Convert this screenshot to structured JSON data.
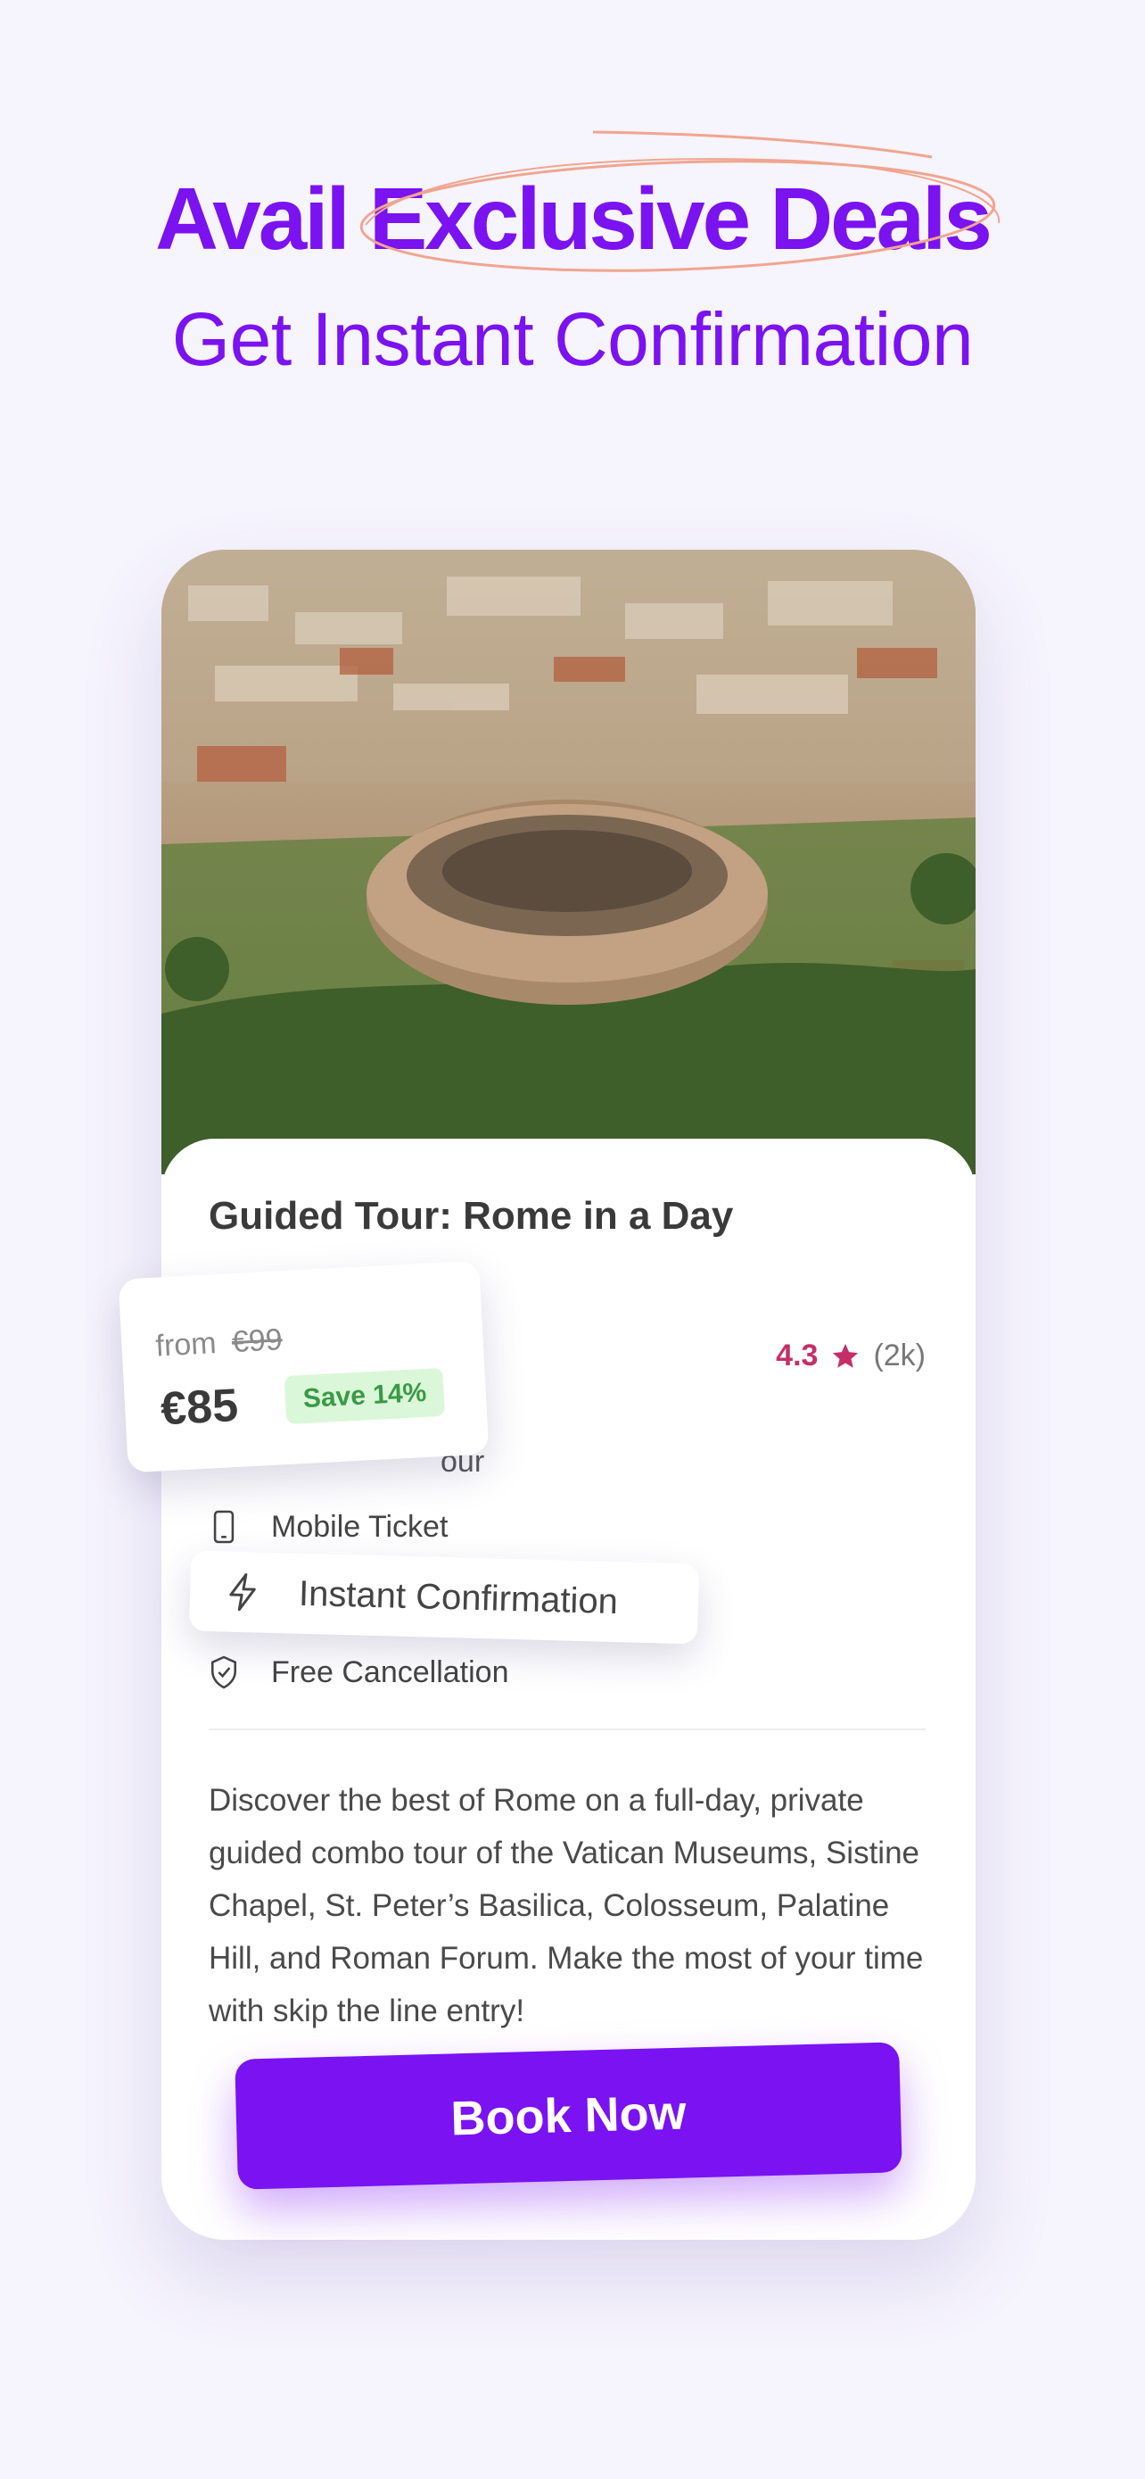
{
  "header": {
    "headline": "Avail Exclusive Deals",
    "subheadline": "Get Instant Confirmation"
  },
  "tour": {
    "title": "Guided Tour: Rome in a Day",
    "image_alt": "Aerial view of the Colosseum in Rome",
    "rating": {
      "score": "4.3",
      "count": "(2k)"
    },
    "features": {
      "hidden_text": "our",
      "mobile_ticket": "Mobile Ticket",
      "instant_confirmation": "Instant Confirmation",
      "free_cancellation": "Free Cancellation"
    },
    "description": "Discover the best of Rome on a full-day, private guided combo tour of the Vatican Museums, Sistine Chapel, St. Peter’s Basilica, Colosseum, Palatine Hill, and Roman Forum. Make the most of your time with skip the line entry!"
  },
  "price": {
    "from_label": "from",
    "original": "€99",
    "current": "€85",
    "save_badge": "Save 14%"
  },
  "cta": {
    "label": "Book Now"
  },
  "colors": {
    "brand_purple": "#7b12f0",
    "rating_pink": "#c42f6a",
    "save_green_bg": "#dbf7d9",
    "save_green_text": "#3a9a45",
    "scribble": "#f0a58f",
    "page_bg": "#f6f4fd"
  },
  "icons": [
    "star-icon",
    "mobile-ticket-icon",
    "lightning-icon",
    "shield-check-icon"
  ]
}
